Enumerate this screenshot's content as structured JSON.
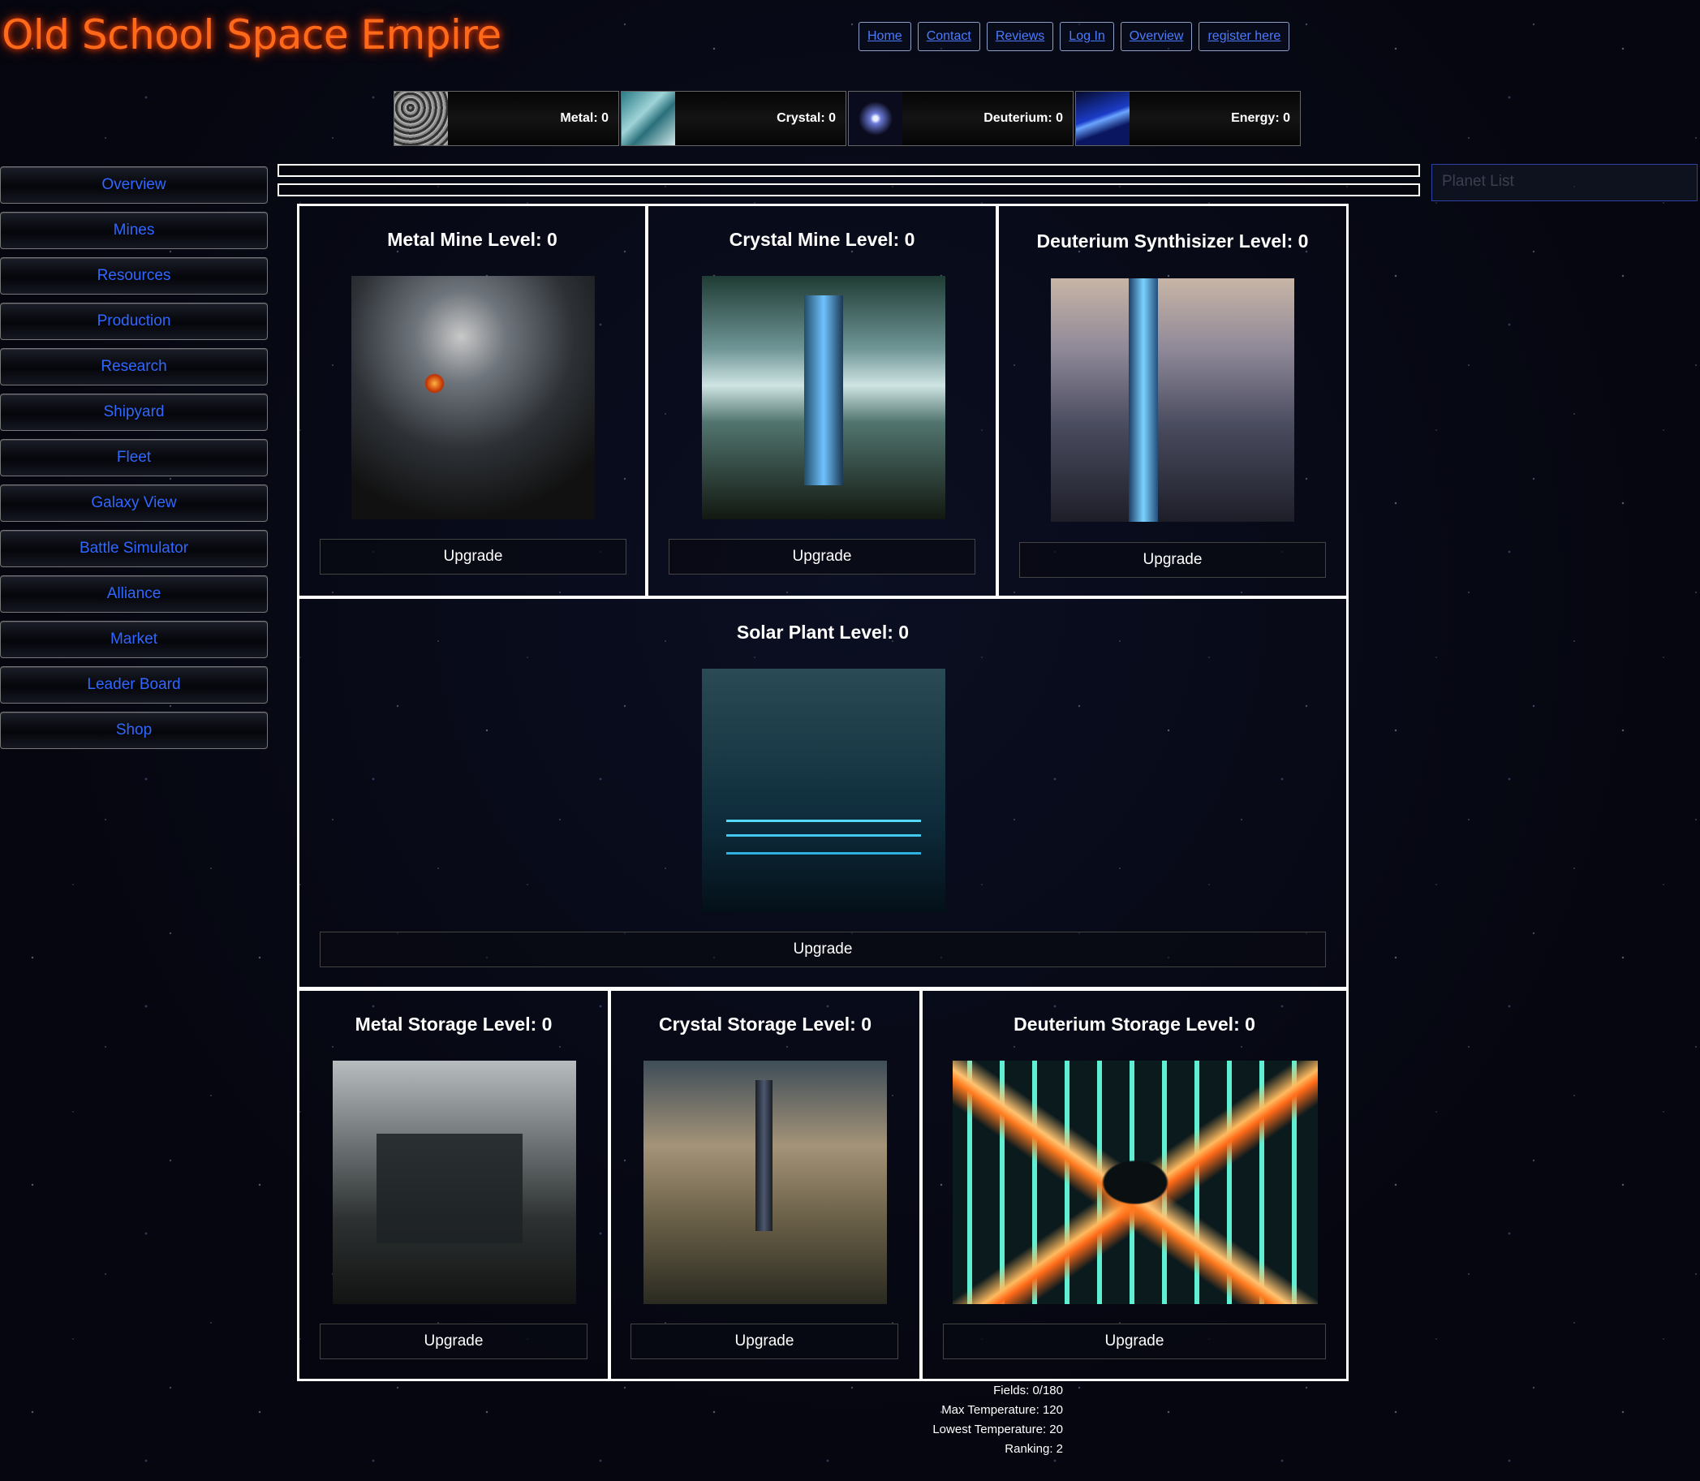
{
  "site": {
    "title": "Old School Space Empire"
  },
  "topnav": [
    "Home",
    "Contact",
    "Reviews",
    "Log In",
    "Overview",
    "register here"
  ],
  "resources": [
    {
      "label": "Metal: 0"
    },
    {
      "label": "Crystal: 0"
    },
    {
      "label": "Deuterium: 0"
    },
    {
      "label": "Energy: 0"
    }
  ],
  "sidebar": [
    "Overview",
    "Mines",
    "Resources",
    "Production",
    "Research",
    "Shipyard",
    "Fleet",
    "Galaxy View",
    "Battle Simulator",
    "Alliance",
    "Market",
    "Leader Board",
    "Shop"
  ],
  "planet_list": {
    "placeholder": "Planet List"
  },
  "buildings": {
    "metal_mine": {
      "title": "Metal Mine Level: 0",
      "button": "Upgrade"
    },
    "crystal_mine": {
      "title": "Crystal Mine Level: 0",
      "button": "Upgrade"
    },
    "deuterium_synthesizer": {
      "title": "Deuterium Synthisizer Level: 0",
      "button": "Upgrade"
    },
    "solar_plant": {
      "title": "Solar Plant Level: 0",
      "button": "Upgrade"
    },
    "metal_storage": {
      "title": "Metal Storage Level: 0",
      "button": "Upgrade"
    },
    "crystal_storage": {
      "title": "Crystal Storage Level: 0",
      "button": "Upgrade"
    },
    "deuterium_storage": {
      "title": "Deuterium Storage Level: 0",
      "button": "Upgrade"
    }
  },
  "planet_info": {
    "fields": "Fields: 0/180",
    "max_temp": "Max Temperature: 120",
    "low_temp": "Lowest Temperature: 20",
    "ranking": "Ranking: 2"
  }
}
